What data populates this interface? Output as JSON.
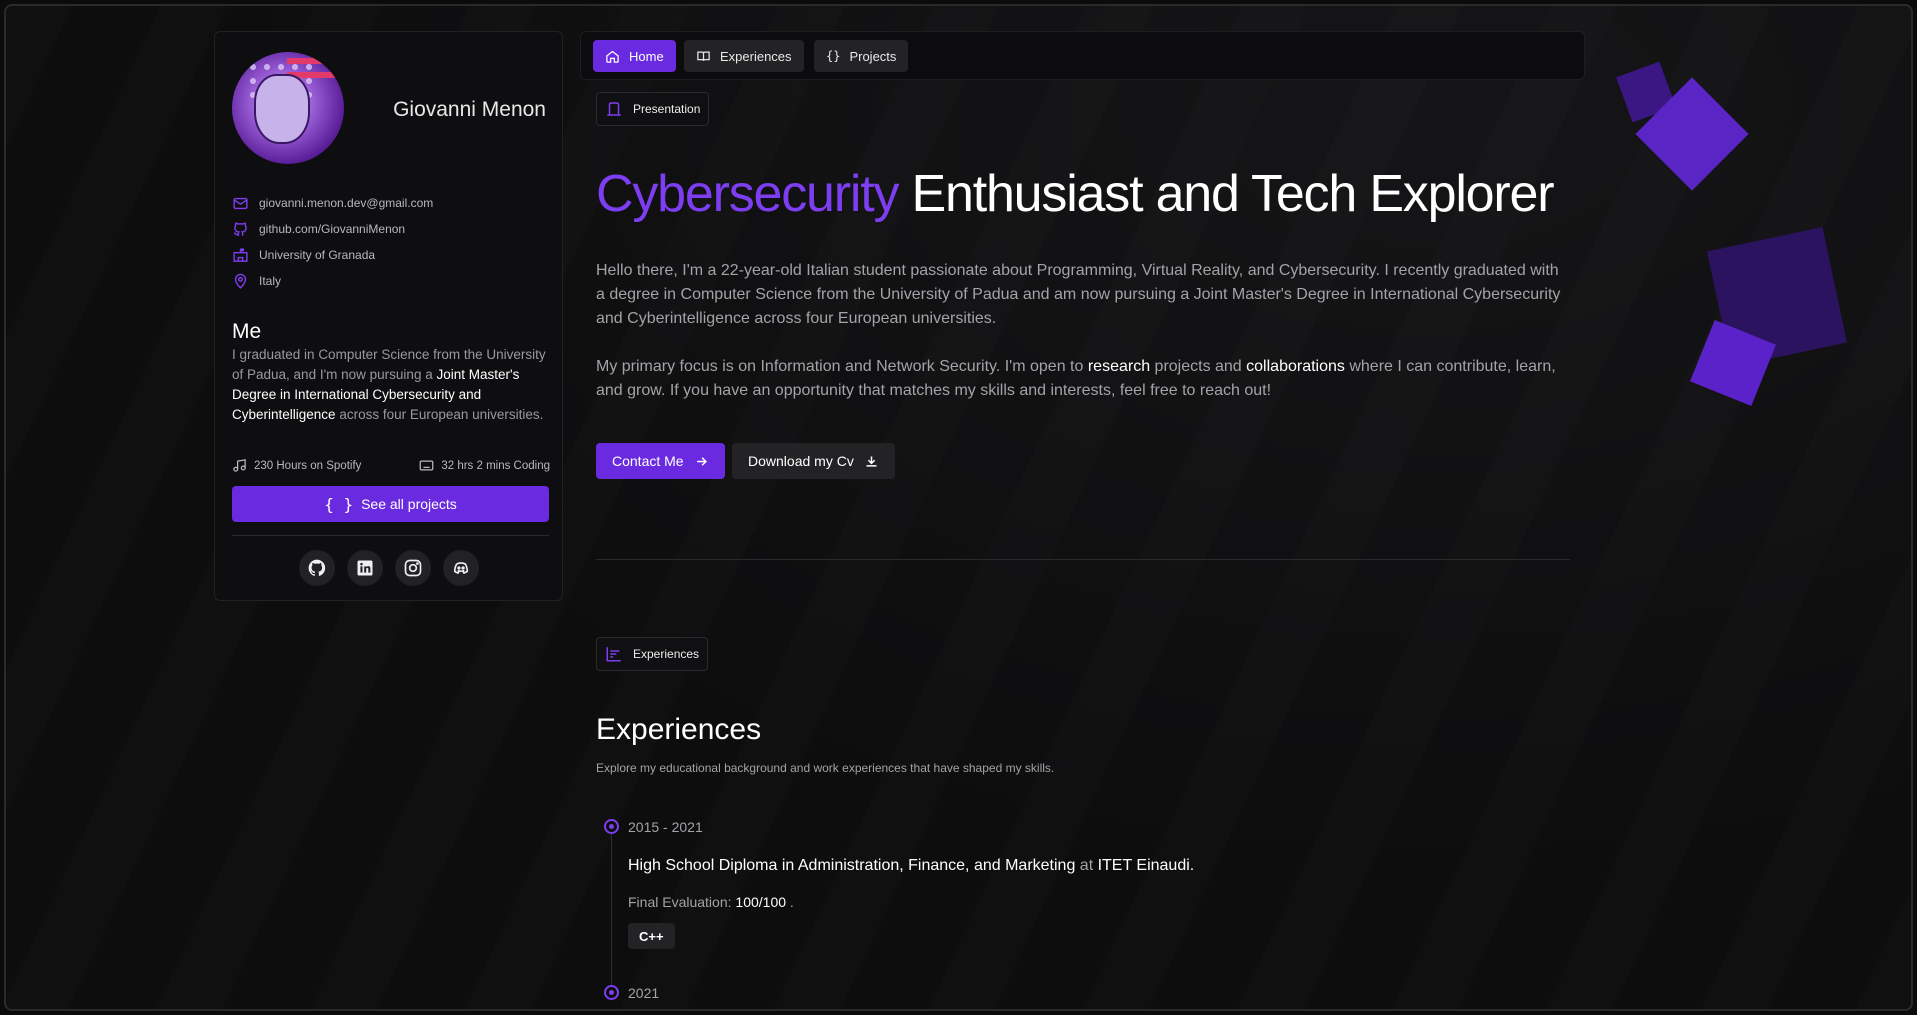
{
  "profile": {
    "name": "Giovanni Menon",
    "contacts": [
      {
        "icon": "mail-icon",
        "text": "giovanni.menon.dev@gmail.com"
      },
      {
        "icon": "github-icon",
        "text": "github.com/GiovanniMenon"
      },
      {
        "icon": "school-icon",
        "text": "University of Granada"
      },
      {
        "icon": "location-pin-icon",
        "text": "Italy"
      }
    ],
    "me_title": "Me",
    "me_text_1": "I graduated in Computer Science from the University of Padua, and I'm now pursuing a ",
    "me_text_hl": "Joint Master's Degree in International Cybersecurity and Cyberintelligence",
    "me_text_2": " across four European universities.",
    "stat_spotify": "230 Hours on Spotify",
    "stat_coding": "32 hrs 2 mins Coding",
    "projects_button": "See all projects",
    "socials": [
      "github-icon",
      "linkedin-icon",
      "instagram-icon",
      "discord-icon"
    ]
  },
  "nav": {
    "home": "Home",
    "experiences": "Experiences",
    "projects": "Projects"
  },
  "hero": {
    "chip": "Presentation",
    "headline_accent": "Cybersecurity",
    "headline_rest": " Enthusiast and Tech Explorer",
    "para1": "Hello there, I'm a 22-year-old Italian student passionate about Programming, Virtual Reality, and Cybersecurity. I recently graduated with a degree in Computer Science from the University of Padua and am now pursuing a Joint Master's Degree in International Cybersecurity and Cyberintelligence across four European universities.",
    "para2_a": "My primary focus is on Information and Network Security. I'm open to ",
    "para2_hl1": "research",
    "para2_b": " projects and ",
    "para2_hl2": "collaborations",
    "para2_c": " where I can contribute, learn, and grow. If you have an opportunity that matches my skills and interests, feel free to reach out!",
    "contact_button": "Contact Me",
    "cv_button": "Download my Cv"
  },
  "experiences": {
    "chip": "Experiences",
    "title": "Experiences",
    "subtitle": "Explore my educational background and work experiences that have shaped my skills.",
    "entries": [
      {
        "date": "2015 - 2021",
        "title": "High School Diploma in Administration, Finance, and Marketing",
        "at": " at ",
        "org": "ITET Einaudi.",
        "eval_label": "Final Evaluation: ",
        "eval_value": "100/100",
        "eval_end": " .",
        "tag": "C++"
      },
      {
        "date": "2021"
      }
    ]
  },
  "colors": {
    "accent": "#6a2be0",
    "accent_text": "#7d3df0",
    "background": "#0b0b0c"
  }
}
